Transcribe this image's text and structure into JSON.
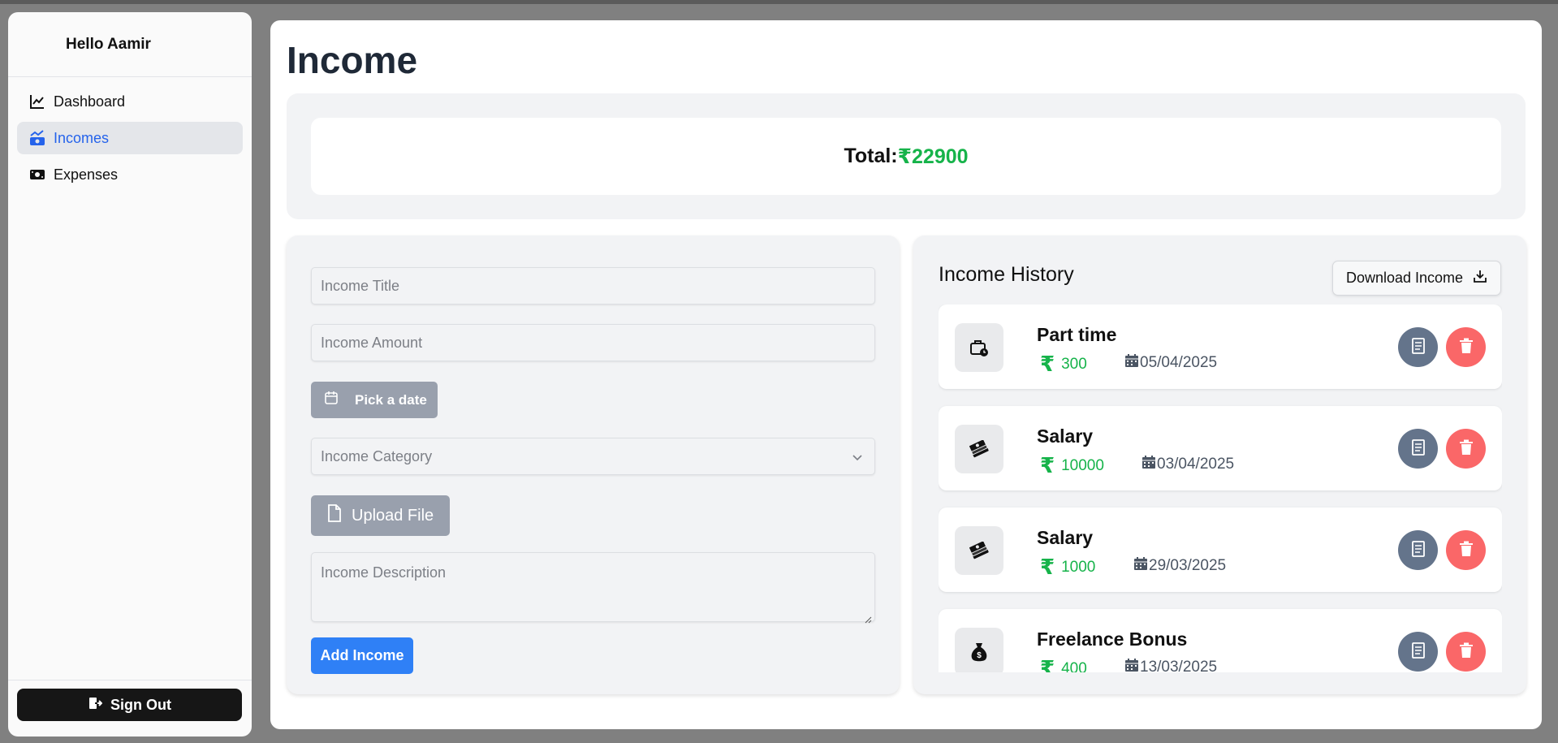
{
  "sidebar": {
    "greeting": "Hello Aamir",
    "items": [
      {
        "label": "Dashboard",
        "icon": "chart-line-icon",
        "active": false
      },
      {
        "label": "Incomes",
        "icon": "money-trend-icon",
        "active": true
      },
      {
        "label": "Expenses",
        "icon": "money-bill-icon",
        "active": false
      }
    ],
    "signout_label": "Sign Out"
  },
  "page": {
    "title": "Income",
    "total_label": "Total:",
    "total_value": "₹22900"
  },
  "form": {
    "title_placeholder": "Income Title",
    "amount_placeholder": "Income Amount",
    "date_button": "Pick a date",
    "category_placeholder": "Income Category",
    "upload_button": "Upload File",
    "description_placeholder": "Income Description",
    "submit_button": "Add Income"
  },
  "history": {
    "title": "Income History",
    "download_button": "Download Income",
    "entries": [
      {
        "title": "Part time",
        "amount": "300",
        "date": "05/04/2025",
        "icon": "briefcase-clock-icon"
      },
      {
        "title": "Salary",
        "amount": "10000",
        "date": "03/04/2025",
        "icon": "money-stack-icon"
      },
      {
        "title": "Salary",
        "amount": "1000",
        "date": "29/03/2025",
        "icon": "money-stack-icon"
      },
      {
        "title": "Freelance Bonus",
        "amount": "400",
        "date": "13/03/2025",
        "icon": "money-bag-icon"
      }
    ]
  },
  "colors": {
    "accent": "#2563eb",
    "positive": "#16b34a",
    "delete": "#fa6768",
    "doc_button": "#64748b",
    "primary_button": "#2f80f6"
  }
}
